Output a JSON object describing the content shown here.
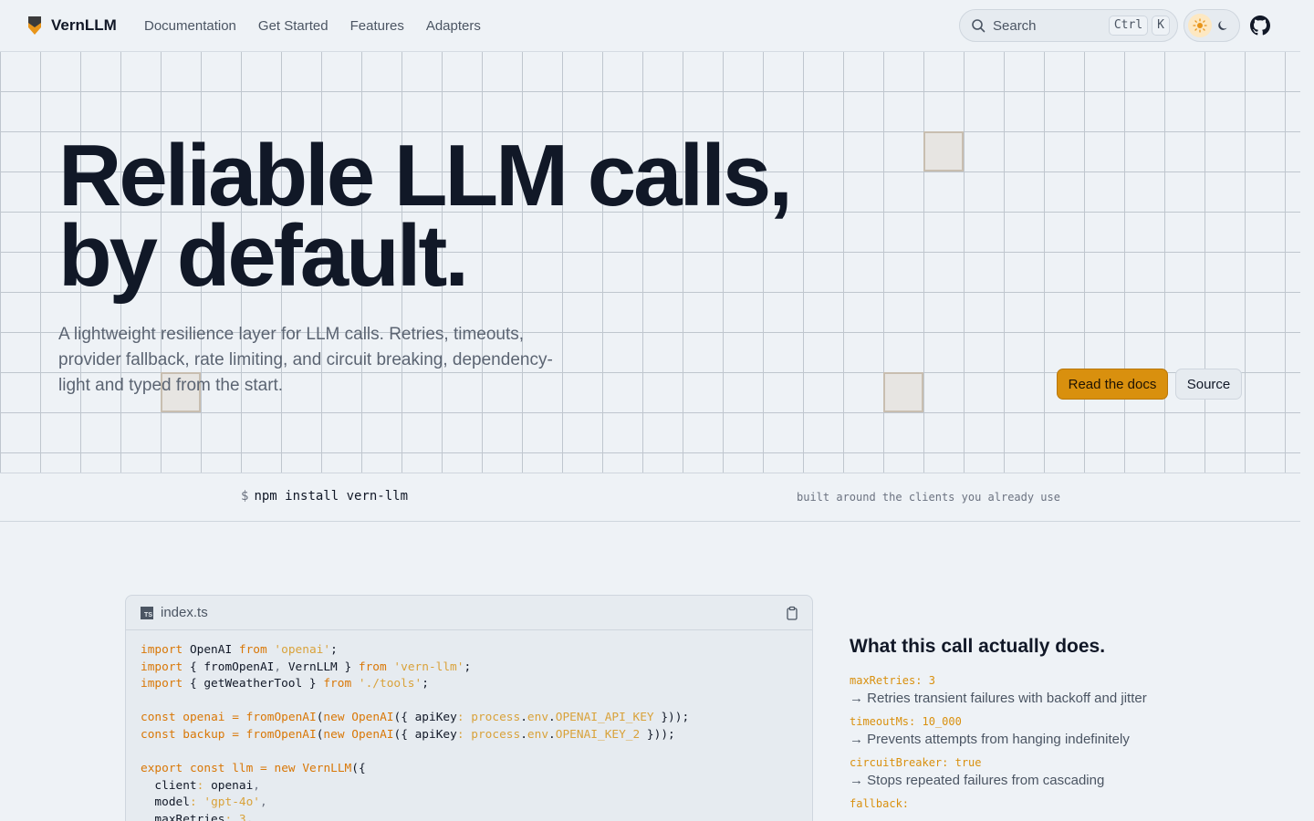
{
  "nav": {
    "brand": "VernLLM",
    "links": [
      "Documentation",
      "Get Started",
      "Features",
      "Adapters"
    ],
    "search": {
      "label": "Search",
      "kbd1": "Ctrl",
      "kbd2": "K"
    }
  },
  "hero": {
    "title_line1": "Reliable LLM calls,",
    "title_line2": "by default.",
    "subtitle": "A lightweight resilience layer for LLM calls. Retries, timeouts, provider fallback, rate limiting, and circuit breaking, dependency-light and typed from the start.",
    "primary_cta": "Read the docs",
    "secondary_cta": "Source"
  },
  "install": {
    "prompt": "$",
    "command": "npm install vern-llm",
    "note": "built around the clients you already use"
  },
  "code": {
    "filename": "index.ts",
    "badge": "TS"
  },
  "side": {
    "title": "What this call actually does.",
    "options": [
      {
        "key": "maxRetries: 3",
        "desc": "→ Retries transient failures with backoff and jitter"
      },
      {
        "key": "timeoutMs: 10_000",
        "desc": "→ Prevents attempts from hanging indefinitely"
      },
      {
        "key": "circuitBreaker: true",
        "desc": "→ Stops repeated failures from cascading"
      },
      {
        "key": "fallback:",
        "desc": ""
      }
    ]
  },
  "colors": {
    "accent": "#d9900e",
    "background": "#eef2f6",
    "text": "#111827"
  }
}
